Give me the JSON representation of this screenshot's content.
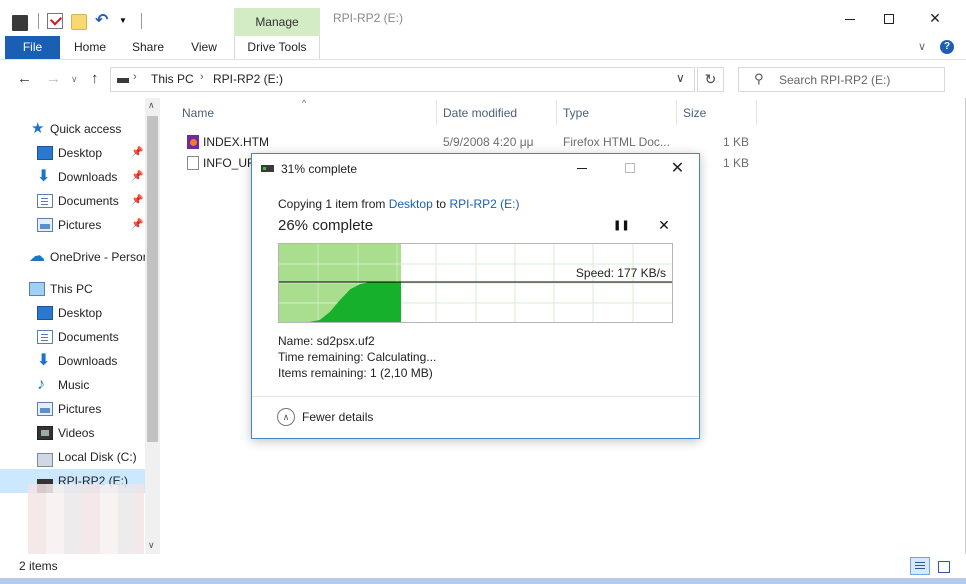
{
  "titlebar": {
    "title": "RPI-RP2 (E:)",
    "manage_tab": "Manage"
  },
  "ribbon": {
    "tabs": [
      "File",
      "Home",
      "Share",
      "View",
      "Drive Tools"
    ]
  },
  "address": {
    "breadcrumbs": [
      "This PC",
      "RPI-RP2 (E:)"
    ],
    "search_placeholder": "Search RPI-RP2 (E:)"
  },
  "nav": {
    "quick_access": "Quick access",
    "quick_items": [
      "Desktop",
      "Downloads",
      "Documents",
      "Pictures"
    ],
    "onedrive": "OneDrive - Persor",
    "this_pc": "This PC",
    "pc_items": [
      "Desktop",
      "Documents",
      "Downloads",
      "Music",
      "Pictures",
      "Videos",
      "Local Disk (C:)",
      "RPI-RP2 (E:)"
    ]
  },
  "filelist": {
    "columns": [
      "Name",
      "Date modified",
      "Type",
      "Size"
    ],
    "rows": [
      {
        "name": "INDEX.HTM",
        "date": "5/9/2008 4:20 μμ",
        "type": "Firefox HTML Doc...",
        "size": "1 KB"
      },
      {
        "name": "INFO_UF.",
        "date": "",
        "type": "",
        "size": "1 KB"
      }
    ]
  },
  "status": {
    "items": "2 items"
  },
  "dialog": {
    "title": "31% complete",
    "copying_prefix": "Copying 1 item from",
    "from": "Desktop",
    "to_word": "to",
    "to": "RPI-RP2 (E:)",
    "percent_text": "26% complete",
    "speed": "Speed: 177 KB/s",
    "name": "Name:  sd2psx.uf2",
    "time_remaining": "Time remaining:  Calculating...",
    "items_remaining": "Items remaining:  1 (2,10 MB)",
    "fewer_details": "Fewer details",
    "progress": 0.31,
    "speed_curve": [
      0,
      0,
      0,
      0,
      0.05,
      0.25,
      0.55,
      0.82,
      0.95,
      1,
      1,
      1,
      1
    ],
    "colors": {
      "fill_done": "#a9de8e",
      "fill_speed": "#16b02a"
    }
  }
}
